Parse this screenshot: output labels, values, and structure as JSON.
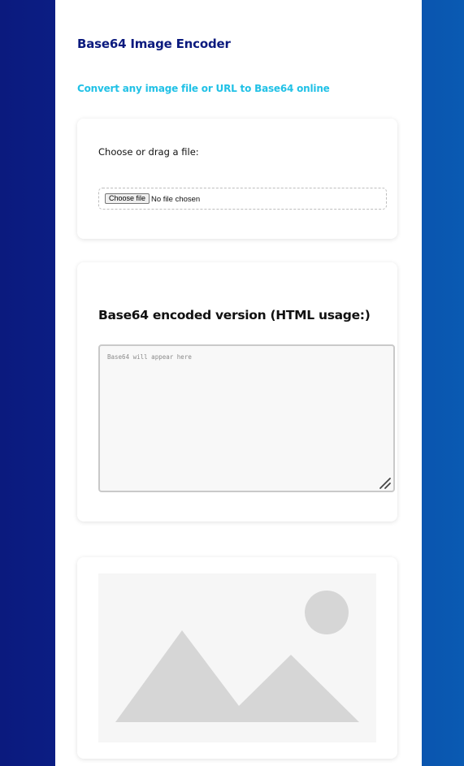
{
  "header": {
    "title": "Base64 Image Encoder",
    "subtitle": "Convert any image file or URL to Base64 online"
  },
  "upload": {
    "label": "Choose or drag a file:",
    "button_label": "Choose file",
    "status": "No file chosen"
  },
  "output": {
    "heading": "Base64 encoded version (HTML usage:)",
    "placeholder": "Base64 will appear here",
    "value": ""
  },
  "preview": {
    "icon": "image-placeholder-icon"
  },
  "colors": {
    "title": "#0b1a7e",
    "subtitle": "#21c1e6",
    "background_left": "#0b1a7e",
    "background_right": "#0a5ab2"
  }
}
